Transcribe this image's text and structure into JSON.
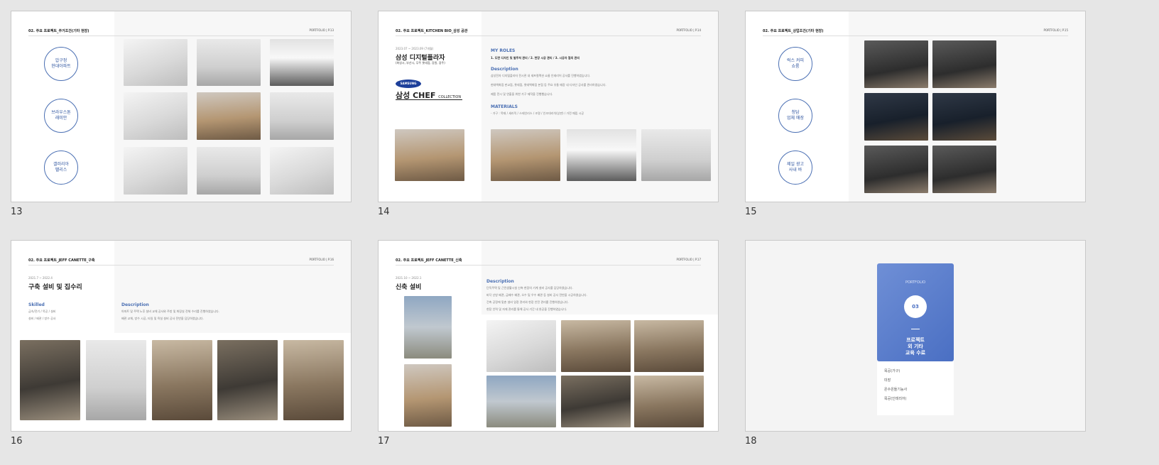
{
  "slides": [
    {
      "number": "13",
      "header": "02. 주요 프로젝트_주거조건(기타 현장)",
      "header_right": "PORTFOLIO  |  P.13",
      "circles": [
        "압구정\n현대아파트",
        "브라우스톤\n래미안",
        "갤러리아\n팰리스"
      ]
    },
    {
      "number": "14",
      "header": "02. 주요 프로젝트_KITCHEN BIO_삼성 공관",
      "header_right": "PORTFOLIO  |  P.14",
      "date": "2023.07 ~ 2023.09  (7개월)",
      "title": "삼성 디지털플라자",
      "subtitle": "(화성시, 부산시, 무주 롯데점, 강원, 광주)",
      "logo_samsung": "SAMSUNG",
      "logo_chef": "삼성",
      "logo_chef_2": "CHEF",
      "logo_chef_3": "COLLECTION",
      "roles_heading": "MY ROLES",
      "roles_text": "1. 도면 디자인 및 발주처 관리 / 2. 현장 시공 관리 / 3. 시공자 협의 관리",
      "desc_heading": "Description",
      "desc_lines": [
        "삼성전자 디지털플라자 전시관 내 셰프컬렉션 쇼룸 인테리어 공사를 진행하였습니다.",
        "현대백화점 판교점, 롯데점, 롯데백화점 본점 등 주요 유통 매장 내 디자인 공사를 관리하였습니다.",
        "제품 전시 및 연출을 위한 가구 제작을 진행했습니다."
      ],
      "materials_heading": "MATERIALS",
      "materials_text": "- 가구 : 목재 / 세라믹 / 스테인리스 / 조명 / 인조대리석(상판) / 가전 매립 시공"
    },
    {
      "number": "15",
      "header": "02. 주요 프로젝트_상업조건(기타 현장)",
      "header_right": "PORTFOLIO  |  P.15",
      "circles": [
        "럭스 커피\n쇼룸",
        "청담\n업체 매장",
        "제일 광고\n사내 바"
      ]
    },
    {
      "number": "16",
      "header": "02. 주요 프로젝트_JEFF CANETTE_구축",
      "header_right": "PORTFOLIO  |  P.16",
      "date": "2021.7 ~ 2022.4",
      "title": "구축 설비 및 집수리",
      "skilled_heading": "Skilled",
      "skilled_lines": [
        "금속/전기 / 목공 / 설비",
        "설비 / 배관 / 방수 공사"
      ],
      "desc_heading": "Description",
      "desc_lines": [
        "아파트 및 주택 노후 설비 교체 공사와 주방 및 화장실 전체 수리를 진행하였습니다.",
        "배관 교체, 방수 시공, 타일 및 욕실 설비 공사 전반을 담당하였습니다."
      ]
    },
    {
      "number": "17",
      "header": "02. 주요 프로젝트_JEFF CANETTE_신축",
      "header_right": "PORTFOLIO  |  P.17",
      "date": "2021.10 ~ 2022.1",
      "title": "신축 설비",
      "desc_heading": "Description",
      "desc_lines": [
        "단독주택 및 근린생활시설 신축 현장의 기계 설비 공사를 담당하였습니다.",
        "바닥 난방 배관, 급배수 배관, 오수 및 우수 배관 등 설비 공사 전반을 시공하였습니다.",
        "건축 공정에 맞춘 설비 일정 관리와 현장 안전 관리를 진행하였습니다.",
        "현장 인력 및 자재 관리를 통해 공사 기간 내 완공을 진행하였습니다."
      ]
    },
    {
      "number": "18",
      "card_label": "PORTFOLIO",
      "card_num": "03",
      "card_title": "프로젝트\n외 기타\n교육 수료",
      "list": [
        "목공(가구)",
        "미장",
        "온수온돌기능사",
        "목공(인테리어)"
      ]
    }
  ]
}
